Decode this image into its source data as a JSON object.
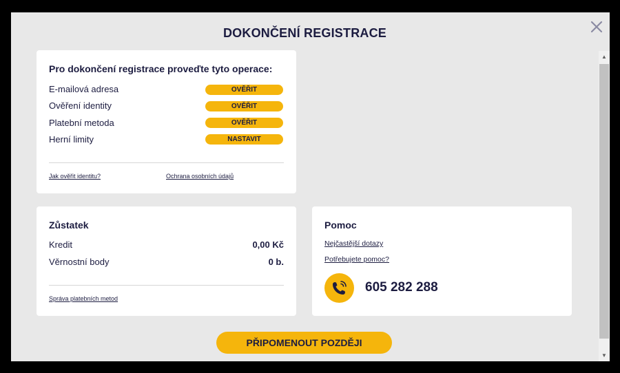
{
  "modal": {
    "title": "DOKONČENÍ REGISTRACE",
    "close_icon": "close-icon"
  },
  "tasks": {
    "heading": "Pro dokončení registrace proveďte tyto operace:",
    "items": [
      {
        "label": "E-mailová adresa",
        "action": "OVĚŘIT"
      },
      {
        "label": "Ověření identity",
        "action": "OVĚŘIT"
      },
      {
        "label": "Platební metoda",
        "action": "OVĚŘIT"
      },
      {
        "label": "Herní limity",
        "action": "NASTAVIT"
      }
    ],
    "links": {
      "verify_identity": "Jak ověřit identitu?",
      "privacy": "Ochrana osobních údajů"
    }
  },
  "balance": {
    "heading": "Zůstatek",
    "rows": [
      {
        "label": "Kredit",
        "value": "0,00 Kč"
      },
      {
        "label": "Věrnostní body",
        "value": "0 b."
      }
    ],
    "manage_link": "Správa platebních metod"
  },
  "help": {
    "heading": "Pomoc",
    "faq_link": "Nejčastější dotazy",
    "need_help_link": "Potřebujete pomoc?",
    "phone": "605 282 288",
    "phone_icon": "phone-icon"
  },
  "footer": {
    "remind_label": "PŘIPOMENOUT POZDĚJI"
  },
  "colors": {
    "accent": "#f5b50c",
    "text": "#1c1c40",
    "background": "#e8e8e8"
  }
}
